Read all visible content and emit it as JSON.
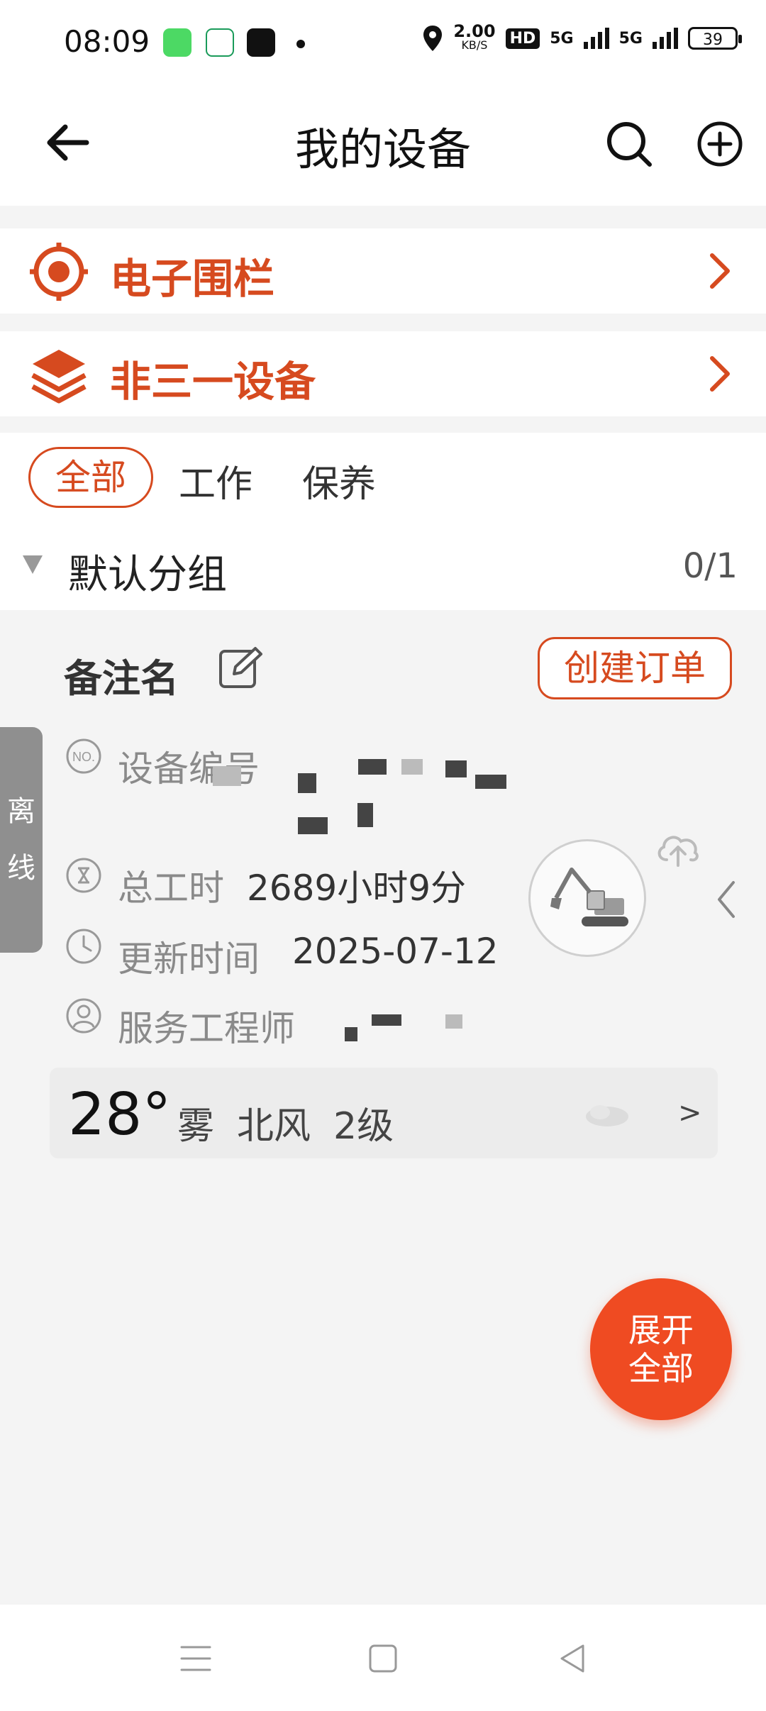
{
  "status_bar": {
    "time": "08:09",
    "net_speed": "2.00",
    "net_unit": "KB/S",
    "hd": "HD",
    "sig1": "5G",
    "sig2": "5G",
    "battery": "39"
  },
  "header": {
    "title": "我的设备"
  },
  "menu": [
    {
      "label": "电子围栏",
      "icon": "target-icon"
    },
    {
      "label": "非三一设备",
      "icon": "layers-icon"
    }
  ],
  "tabs": [
    "全部",
    "工作",
    "保养"
  ],
  "group": {
    "name": "默认分组",
    "count": "0/1"
  },
  "card": {
    "name": "备注名",
    "order_button": "创建订单",
    "offline": [
      "离",
      "线"
    ],
    "device_no_label": "设备编号",
    "work_hours_label": "总工时",
    "work_hours_value": "2689小时9分",
    "update_label": "更新时间",
    "update_value": "2025-07-12",
    "engineer_label": "服务工程师"
  },
  "weather": {
    "temp": "28°",
    "condition": "雾",
    "wind": "北风",
    "level": "2级",
    "more": ">"
  },
  "fab": [
    "展开",
    "全部"
  ],
  "colors": {
    "accent": "#d64a1f",
    "fab": "#ef4b22"
  }
}
